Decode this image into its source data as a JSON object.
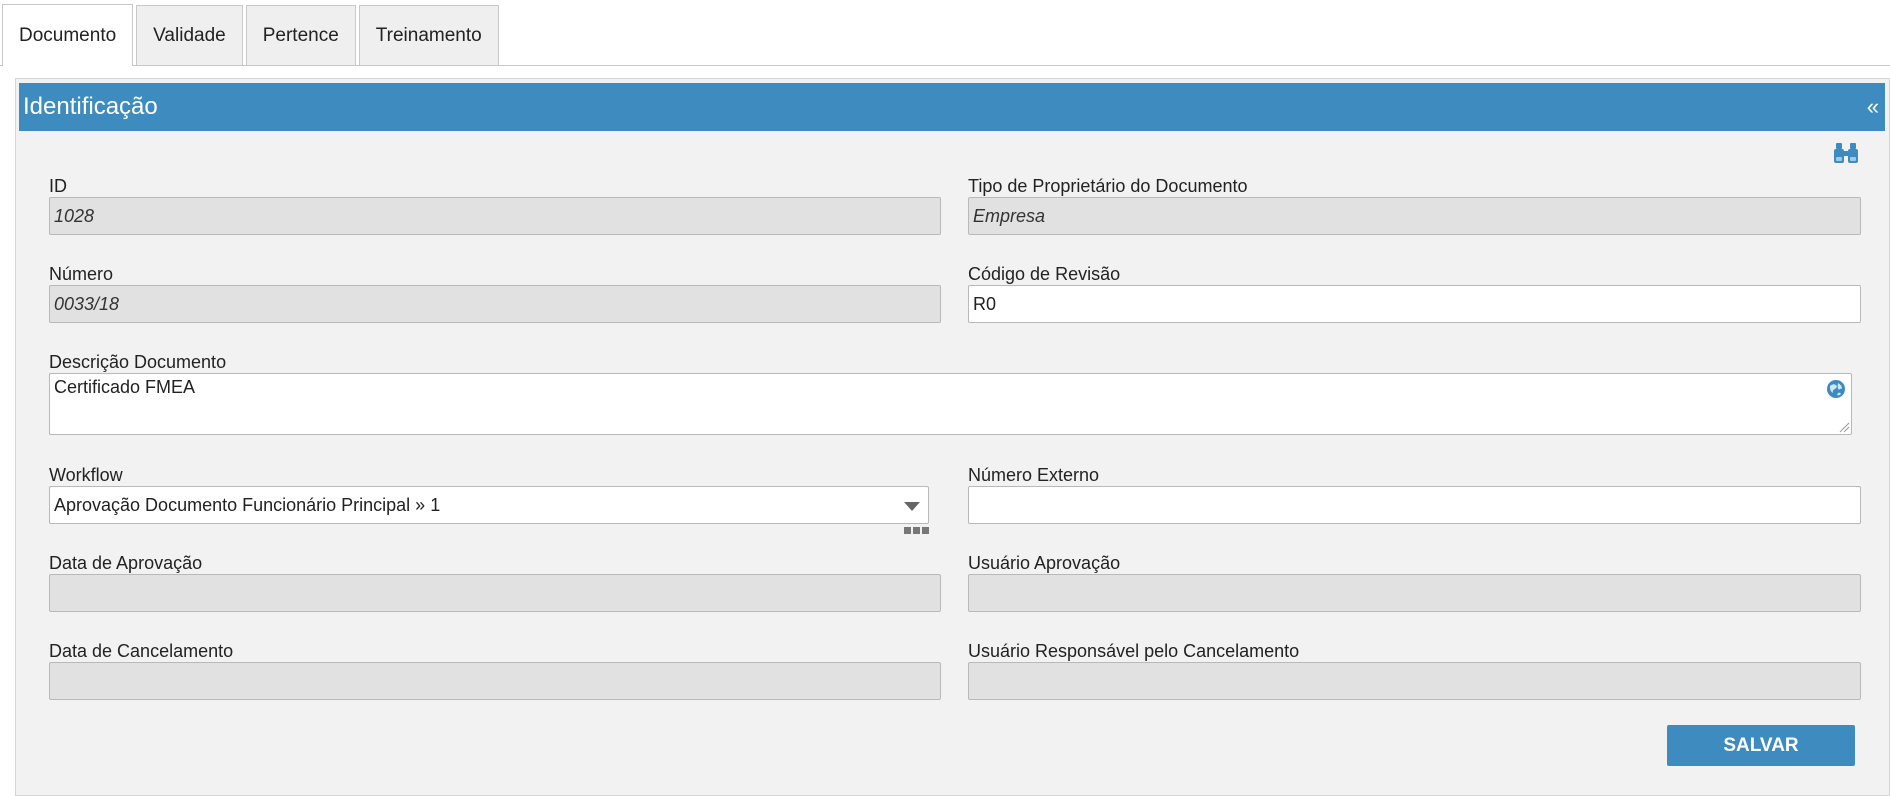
{
  "tabs": [
    {
      "label": "Documento",
      "active": true
    },
    {
      "label": "Validade",
      "active": false
    },
    {
      "label": "Pertence",
      "active": false
    },
    {
      "label": "Treinamento",
      "active": false
    }
  ],
  "panel": {
    "title": "Identificação",
    "collapse_glyph": "«",
    "search_icon": "binoculars-icon"
  },
  "fields": {
    "id": {
      "label": "ID",
      "value": "1028"
    },
    "owner_type": {
      "label": "Tipo de Proprietário do Documento",
      "value": "Empresa"
    },
    "numero": {
      "label": "Número",
      "value": "0033/18"
    },
    "revision_code": {
      "label": "Código de Revisão",
      "value": "R0"
    },
    "description": {
      "label": "Descrição Documento",
      "value": "Certificado FMEA",
      "icon": "globe-icon"
    },
    "workflow": {
      "label": "Workflow",
      "value": "Aprovação Documento Funcionário Principal » 1"
    },
    "external_number": {
      "label": "Número Externo",
      "value": ""
    },
    "approval_date": {
      "label": "Data de Aprovação",
      "value": ""
    },
    "approval_user": {
      "label": "Usuário Aprovação",
      "value": ""
    },
    "cancel_date": {
      "label": "Data de Cancelamento",
      "value": ""
    },
    "cancel_user": {
      "label": "Usuário Responsável pelo Cancelamento",
      "value": ""
    }
  },
  "actions": {
    "save_label": "SALVAR"
  },
  "colors": {
    "accent": "#3e8cbf",
    "panel_bg": "#f2f2f2",
    "readonly_bg": "#e1e1e1"
  }
}
